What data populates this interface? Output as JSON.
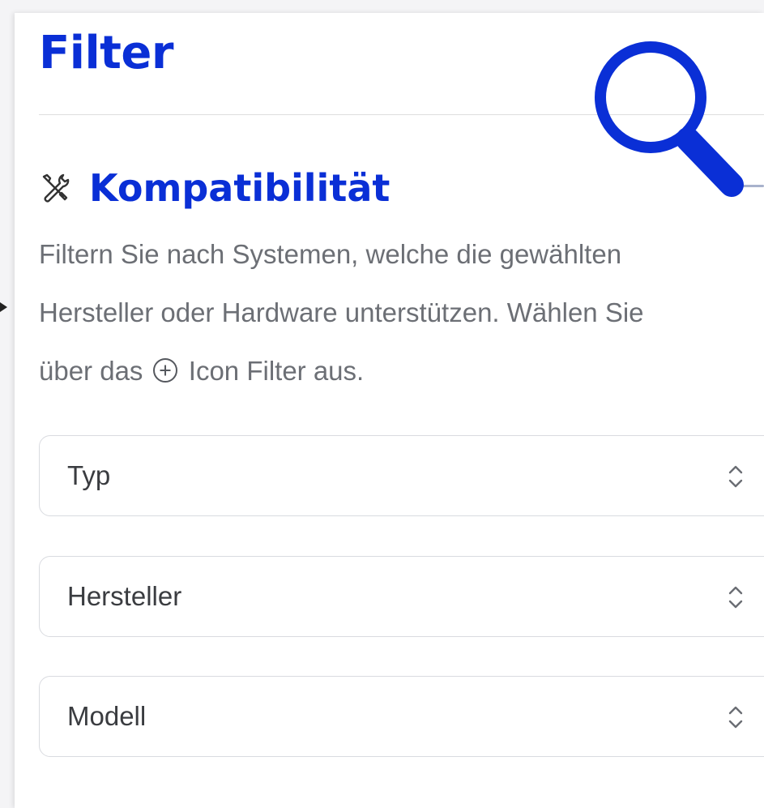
{
  "panel": {
    "title": "Filter"
  },
  "section": {
    "icon": "tools-icon",
    "title": "Kompatibilität",
    "description": {
      "line1": "Filtern Sie nach Systemen, welche die gewählten",
      "line2": "Hersteller oder Hardware unterstützen. Wählen Sie",
      "line3_before": "über das",
      "line3_icon": "plus-circle-icon",
      "line3_after": "Icon Filter aus."
    }
  },
  "selects": [
    {
      "label": "Typ",
      "icon": "chevron-updown-icon"
    },
    {
      "label": "Hersteller",
      "icon": "chevron-updown-icon"
    },
    {
      "label": "Modell",
      "icon": "chevron-updown-icon"
    }
  ],
  "overlay": {
    "icon": "search-icon"
  },
  "colors": {
    "accent": "#0a2fd6",
    "text_muted": "#6c6f75",
    "border": "#d9dbe0"
  }
}
